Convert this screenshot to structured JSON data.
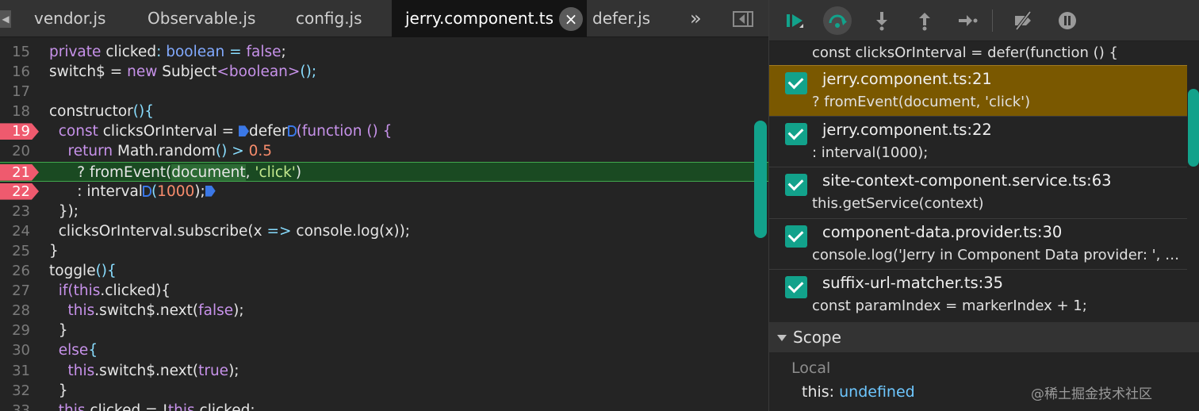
{
  "tabs": [
    {
      "label": "vendor.js",
      "active": false
    },
    {
      "label": "Observable.js",
      "active": false
    },
    {
      "label": "config.js",
      "active": false
    },
    {
      "label": "jerry.component.ts",
      "active": true
    },
    {
      "label": "defer.js",
      "active": false
    }
  ],
  "tab_more_glyph": "»",
  "tab_close_glyph": "×",
  "code": {
    "line_numbers": [
      "15",
      "16",
      "17",
      "18",
      "19",
      "20",
      "21",
      "22",
      "23",
      "24",
      "25",
      "26",
      "27",
      "28",
      "29",
      "30",
      "31",
      "32",
      "33"
    ],
    "breakpoint_lines": [
      "19",
      "21",
      "22"
    ],
    "paused_line": "21",
    "lines": {
      "l15": [
        "private",
        "clicked",
        ":",
        "boolean",
        "=",
        "false",
        ";"
      ],
      "l16": [
        "switch$ =",
        "new",
        "Subject",
        "<boolean>",
        "();"
      ],
      "l18": [
        "constructor",
        "(){"
      ],
      "l19": [
        "const",
        "clicksOrInterval =",
        "defer",
        "(function () {"
      ],
      "l20": [
        "return",
        "Math.random",
        "()",
        ">",
        "0.5"
      ],
      "l21": [
        "? fromEvent(",
        "document",
        ", ",
        "'click'",
        ")"
      ],
      "l22": [
        ": interval",
        "(",
        "1000",
        ");"
      ],
      "l23": [
        "});"
      ],
      "l24": [
        "clicksOrInterval",
        ".subscribe(",
        "x",
        "=>",
        "console.log(",
        "x",
        "));"
      ],
      "l25": [
        "}"
      ],
      "l26": [
        "toggle",
        "(){"
      ],
      "l27": [
        "if(",
        "this",
        ".clicked){"
      ],
      "l28": [
        "this",
        ".switch$.next(",
        "false",
        ");"
      ],
      "l29": [
        "}"
      ],
      "l30": [
        "else",
        "{"
      ],
      "l31": [
        "this",
        ".switch$.next(",
        "true",
        ");"
      ],
      "l32": [
        "}"
      ],
      "l33": [
        "this",
        ".clicked = !",
        "this",
        ".clicked;"
      ]
    }
  },
  "breakpoints": {
    "context": "const clicksOrInterval = defer(function () {",
    "items": [
      {
        "file": "jerry.component.ts:21",
        "code": "? fromEvent(document, 'click')",
        "checked": true,
        "current": true
      },
      {
        "file": "jerry.component.ts:22",
        "code": ": interval(1000);",
        "checked": true,
        "current": false
      },
      {
        "file": "site-context-component.service.ts:63",
        "code": "this.getService(context)",
        "checked": true,
        "current": false
      },
      {
        "file": "component-data.provider.ts:30",
        "code": "console.log('Jerry in Component Data provider: ', ui...",
        "checked": true,
        "current": false
      },
      {
        "file": "suffix-url-matcher.ts:35",
        "code": "const paramIndex = markerIndex + 1;",
        "checked": true,
        "current": false
      }
    ]
  },
  "toolbar_icons": [
    "resume-icon",
    "step-over-icon",
    "step-into-icon",
    "step-out-icon",
    "step-icon",
    "deactivate-breakpoints-icon",
    "pause-on-exceptions-icon"
  ],
  "scope": {
    "header": "Scope",
    "local_label": "Local",
    "this_key": "this",
    "this_sep": ":",
    "this_value": "undefined"
  },
  "watermark": "@稀土掘金技术社区",
  "colors": {
    "accent": "#12a28b",
    "breakpoint": "#ef5a6e",
    "paused_line": "#1a4a22",
    "current_breakpoint": "#7a5800"
  }
}
